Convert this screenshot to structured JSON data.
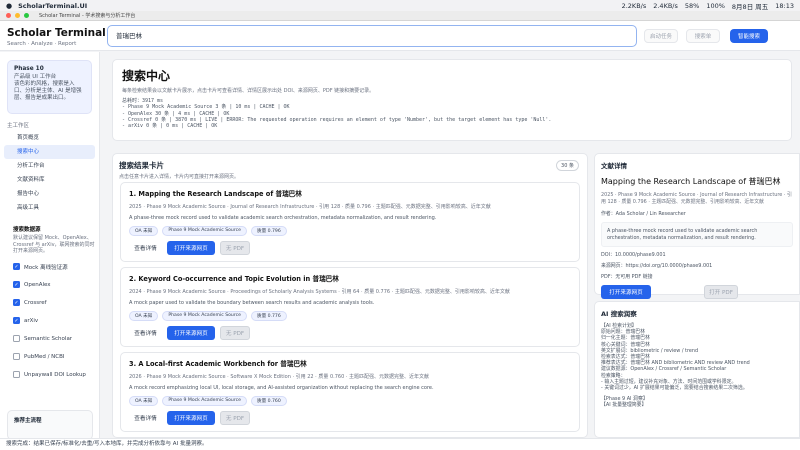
{
  "menubar": {
    "app": "ScholarTerminal.UI",
    "battery": "58%",
    "wifi_pct": "100%",
    "date": "8月8日 周五",
    "time": "18:13",
    "net_up": "2.2KB/s",
    "net_down": "2.4KB/s"
  },
  "window": {
    "title": "Scholar Terminal - 学术搜索与分析工作台"
  },
  "header": {
    "brand": "Scholar Terminal",
    "subtitle": "Search · Analyze · Report",
    "search_value": "普瑞巴林",
    "start_label": "启动任务",
    "search_label": "搜索单",
    "smart_label": "智能搜索"
  },
  "sidebar": {
    "phase_title": "Phase 10",
    "phase_line1": "产品级 UI 工作台",
    "phase_desc": "该色彩的风格，搜索是入口、分析是主体、AI 是增强层、报告是成果出口。",
    "nav_section": "主工作区",
    "nav": [
      "首页概览",
      "搜索中心",
      "分析工作台",
      "文献资料库",
      "报告中心",
      "高级工具"
    ],
    "sources_title": "搜索数据源",
    "sources_note": "默认建议保留 Mock、OpenAlex、Crossref 与 arXiv，联网搜索的同时打开来源网页。",
    "sources": [
      {
        "label": "Mock 离线验证源",
        "on": true
      },
      {
        "label": "OpenAlex",
        "on": true
      },
      {
        "label": "Crossref",
        "on": true
      },
      {
        "label": "arXiv",
        "on": true
      },
      {
        "label": "Semantic Scholar",
        "on": false
      },
      {
        "label": "PubMed / NCBI",
        "on": false
      },
      {
        "label": "Unpaywall DOI Lookup",
        "on": false
      }
    ],
    "recommend_title": "推荐主流程"
  },
  "hero": {
    "title": "搜索中心",
    "desc": "每条检索结果会以文献卡片展示，点击卡片可查看详情、详情区展示出处 DOI、来源网页、PDF 链接和摘要记录。",
    "stats": [
      "总耗时：3917 ms",
      "- Phase 9 Mock Academic Source    3 条 |     10 ms | CACHE | OK",
      "- OpenAlex                        30 条 |      4 ms | CACHE | OK",
      "- Crossref                         0 条 |  3870 ms | LIVE | ERROR: The requested operation requires an element of type 'Number', but the target element has type 'Null'.",
      "- arXiv                            0 条 |      0 ms | CACHE | OK"
    ]
  },
  "results": {
    "title": "搜索结果卡片",
    "subtitle": "点击任意卡片进入详情，卡片内可直接打开来源网页。",
    "count": "30 条",
    "view_label": "查看详情",
    "open_label": "打开来源网页",
    "nopdf_label": "无 PDF",
    "items": [
      {
        "title": "1. Mapping the Research Landscape of 普瑞巴林",
        "meta": "2025 · Phase 9 Mock Academic Source · Journal of Research Infrastructure · 引用 128 · 质量 0.796 · 主题匹配强、元数据完整、引用影响较高、近年文献",
        "desc": "A phase-three mock record used to validate academic search orchestration, metadata normalization, and result rendering.",
        "tag1": "OA 未知",
        "tag2": "Phase 9 Mock Academic Source",
        "tag3": "质量 0.796"
      },
      {
        "title": "2. Keyword Co-occurrence and Topic Evolution in 普瑞巴林",
        "meta": "2024 · Phase 9 Mock Academic Source · Proceedings of Scholarly Analysis Systems · 引用 64 · 质量 0.776 · 主题匹配强、元数据完整、引用影响较高、近年文献",
        "desc": "A mock paper used to validate the boundary between search results and academic analysis tools.",
        "tag1": "OA 未知",
        "tag2": "Phase 9 Mock Academic Source",
        "tag3": "质量 0.776"
      },
      {
        "title": "3. A Local-first Academic Workbench for 普瑞巴林",
        "meta": "2026 · Phase 9 Mock Academic Source · Software X Mock Edition · 引用 22 · 质量 0.760 · 主题匹配强、元数据完整、近年文献",
        "desc": "A mock record emphasizing local UI, local storage, and AI-assisted organization without replacing the search engine core.",
        "tag1": "OA 未知",
        "tag2": "Phase 9 Mock Academic Source",
        "tag3": "质量 0.760"
      }
    ]
  },
  "detail": {
    "heading": "文献详情",
    "title": "Mapping the Research Landscape of 普瑞巴林",
    "meta": "2025 · Phase 9 Mock Academic Source · Journal of Research Infrastructure · 引用 128 · 质量 0.796 · 主题匹配强、元数据完整、引用影响较高、近年文献",
    "authors": "作者：Ada Scholar / Lin Researcher",
    "abstract": "A phase-three mock record used to validate academic search orchestration, metadata normalization, and result rendering.",
    "doi": "DOI：10.0000/phase9.001",
    "source": "来源网页：https://doi.org/10.0000/phase9.001",
    "pdf": "PDF：无可用 PDF 链接",
    "open_label": "打开来源网页",
    "pdf_label": "打开 PDF"
  },
  "ai": {
    "heading": "AI 搜索润察",
    "body": "【AI 检索计划】\n原始问题：普瑞巴林\n归一化主题：普瑞巴林\n核心关键词：普瑞巴林\n英文扩展词：bibliometric / review / trend\n检索表达式：普瑞巴林\n推荐表达式：普瑞巴林 AND bibliometric AND review AND trend\n建议数据源：OpenAlex / Crossref / Semantic Scholar\n检索策略：\n- 输入主题过短，建议补充对象、方法、时间范围或学科限定。\n- 关键词过少，AI 扩展结果可能偏泛，需要结合搜索结果二次筛选。",
    "body2": "【Phase 9 AI 洞察】\n【AI 批量整理简要】"
  },
  "status": "搜索完成：结果已保存/标准化/去重/写入本地库，并完成分析依靠与 AI 批量洞察。"
}
